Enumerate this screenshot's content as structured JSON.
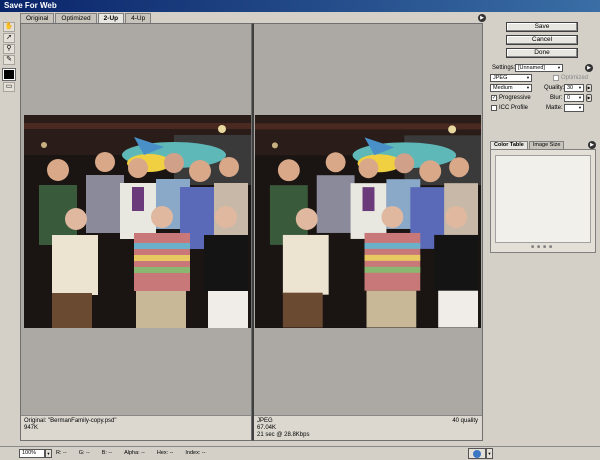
{
  "window": {
    "title": "Save For Web"
  },
  "tabs": [
    {
      "label": "Original"
    },
    {
      "label": "Optimized"
    },
    {
      "label": "2-Up"
    },
    {
      "label": "4-Up"
    }
  ],
  "active_tab": "2-Up",
  "left_pane": {
    "name": "Original: \"BermanFamily-copy.psd\"",
    "size": "947K"
  },
  "right_pane": {
    "format": "JPEG",
    "size": "67.04K",
    "download": "21 sec @ 28.8Kbps",
    "quality_note": "40 quality"
  },
  "buttons": {
    "save": "Save",
    "cancel": "Cancel",
    "done": "Done"
  },
  "settings": {
    "label": "Settings:",
    "preset": "[Unnamed]",
    "format": "JPEG",
    "optimized_label": "Optimized",
    "quality_level": "Medium",
    "quality_label": "Quality:",
    "quality_value": "30",
    "progressive_label": "Progressive",
    "blur_label": "Blur:",
    "blur_value": "0",
    "icc_label": "ICC Profile",
    "matte_label": "Matte:"
  },
  "panel_tabs": [
    {
      "label": "Color Table"
    },
    {
      "label": "Image Size"
    }
  ],
  "status_bar": {
    "zoom": "100%",
    "fields": [
      "R: --",
      "G: --",
      "B: --",
      "Alpha: --",
      "Hex: --",
      "Index: --"
    ]
  },
  "colors": {
    "accent": "#0a246a",
    "panel_bg": "#d4d0c8",
    "pane_bg": "#aca9a5"
  }
}
